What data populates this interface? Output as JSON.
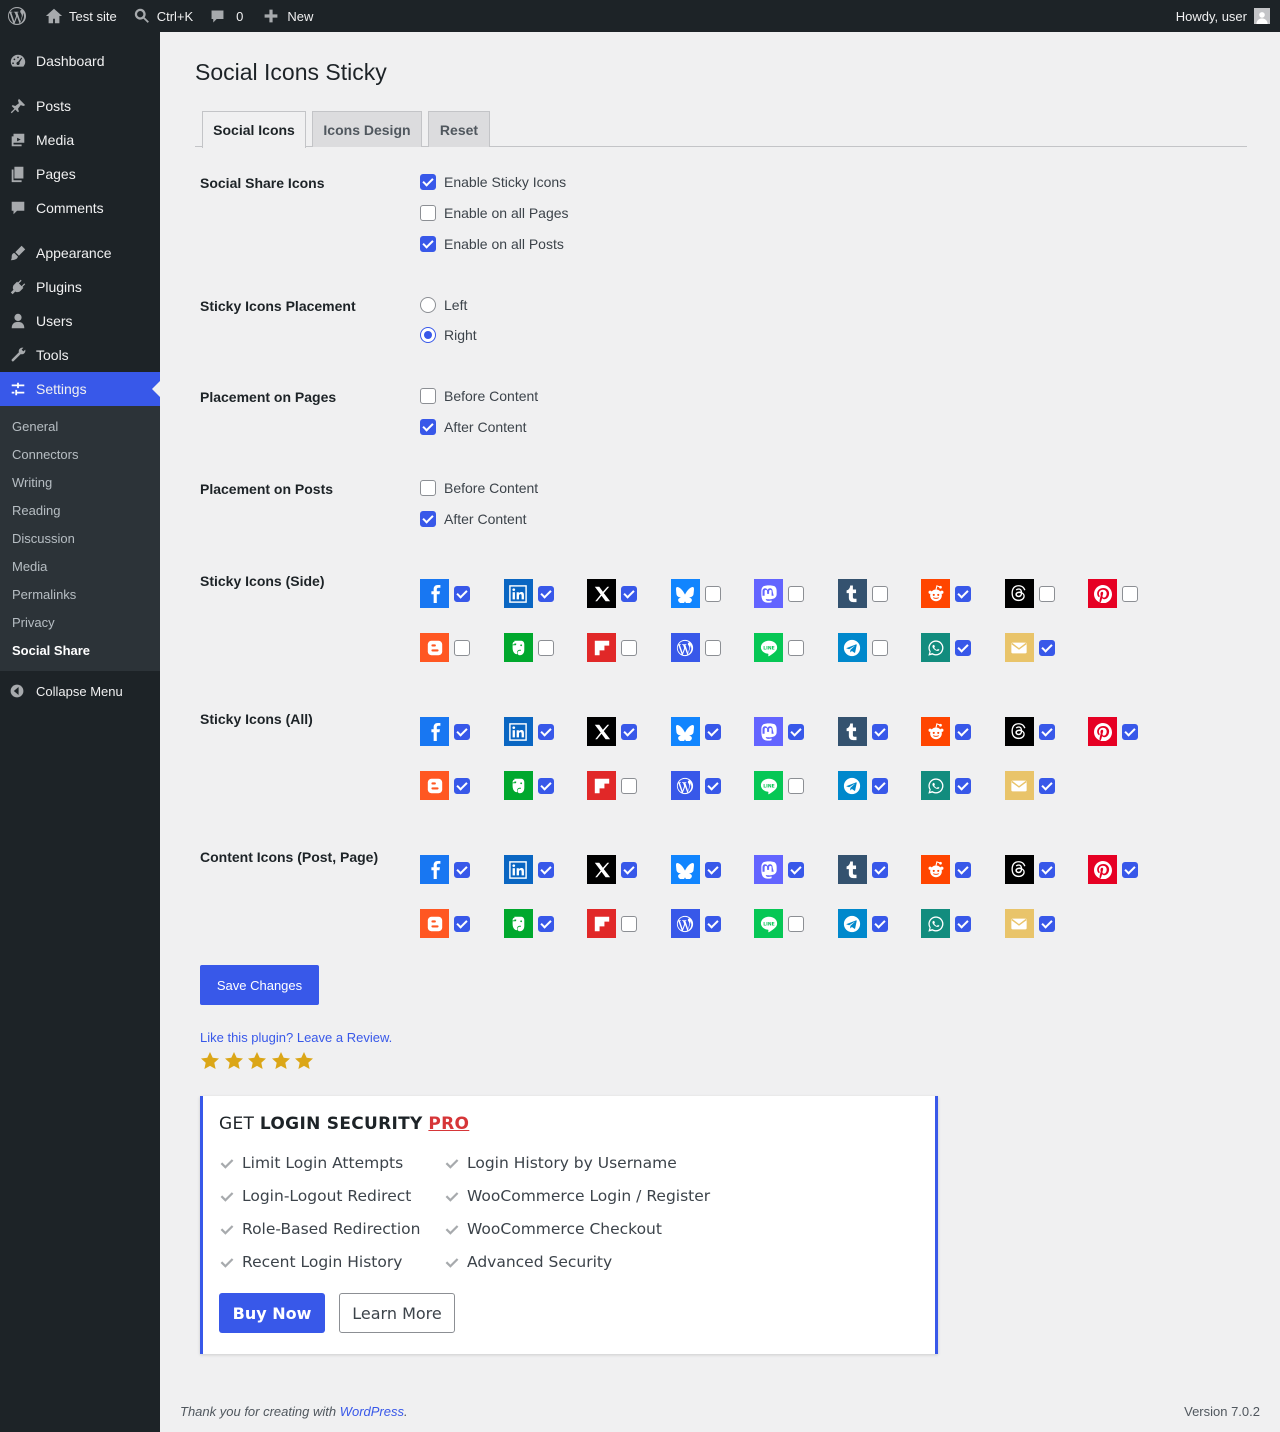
{
  "adminbar": {
    "site_name": "Test site",
    "search_shortcut": "Ctrl+K",
    "comments_count": "0",
    "new_label": "New",
    "greeting": "Howdy, user"
  },
  "sidebar": {
    "items": [
      {
        "label": "Dashboard",
        "icon": "dashboard-icon"
      },
      {
        "label": "Posts",
        "icon": "pin-icon"
      },
      {
        "label": "Media",
        "icon": "media-icon"
      },
      {
        "label": "Pages",
        "icon": "pages-icon"
      },
      {
        "label": "Comments",
        "icon": "comment-icon"
      },
      {
        "label": "Appearance",
        "icon": "brush-icon"
      },
      {
        "label": "Plugins",
        "icon": "plugin-icon"
      },
      {
        "label": "Users",
        "icon": "user-icon"
      },
      {
        "label": "Tools",
        "icon": "wrench-icon"
      },
      {
        "label": "Settings",
        "icon": "settings-icon"
      }
    ],
    "submenu": [
      "General",
      "Connectors",
      "Writing",
      "Reading",
      "Discussion",
      "Media",
      "Permalinks",
      "Privacy",
      "Social Share"
    ],
    "collapse_label": "Collapse Menu"
  },
  "page": {
    "title": "Social Icons Sticky",
    "tabs": [
      "Social Icons",
      "Icons Design",
      "Reset"
    ]
  },
  "settings": {
    "social_share": {
      "label": "Social Share Icons",
      "options": [
        {
          "label": "Enable Sticky Icons",
          "checked": true
        },
        {
          "label": "Enable on all Pages",
          "checked": false
        },
        {
          "label": "Enable on all Posts",
          "checked": true
        }
      ]
    },
    "placement": {
      "label": "Sticky Icons Placement",
      "options": [
        {
          "label": "Left",
          "checked": false
        },
        {
          "label": "Right",
          "checked": true
        }
      ]
    },
    "pages_placement": {
      "label": "Placement on Pages",
      "options": [
        {
          "label": "Before Content",
          "checked": false
        },
        {
          "label": "After Content",
          "checked": true
        }
      ]
    },
    "posts_placement": {
      "label": "Placement on Posts",
      "options": [
        {
          "label": "Before Content",
          "checked": false
        },
        {
          "label": "After Content",
          "checked": true
        }
      ]
    }
  },
  "networks": [
    {
      "name": "facebook",
      "color": "#1877f2"
    },
    {
      "name": "linkedin",
      "color": "#0a66c2"
    },
    {
      "name": "x",
      "color": "#000000"
    },
    {
      "name": "bluesky",
      "color": "#1185fe"
    },
    {
      "name": "mastodon",
      "color": "#6364ff"
    },
    {
      "name": "tumblr",
      "color": "#34526f"
    },
    {
      "name": "reddit",
      "color": "#ff4500"
    },
    {
      "name": "threads",
      "color": "#000000"
    },
    {
      "name": "pinterest",
      "color": "#e60023"
    },
    {
      "name": "blogger",
      "color": "#ff5722"
    },
    {
      "name": "evernote",
      "color": "#00a82d"
    },
    {
      "name": "flipboard",
      "color": "#e12828"
    },
    {
      "name": "wordpress",
      "color": "#3858e9"
    },
    {
      "name": "line",
      "color": "#06c755"
    },
    {
      "name": "telegram",
      "color": "#0088cc"
    },
    {
      "name": "whatsapp",
      "color": "#128c7e"
    },
    {
      "name": "email",
      "color": "#e9c46a"
    }
  ],
  "icon_groups": [
    {
      "label": "Sticky Icons (Side)",
      "checked": [
        true,
        true,
        true,
        false,
        false,
        false,
        true,
        false,
        false,
        false,
        false,
        false,
        false,
        false,
        false,
        true,
        true
      ]
    },
    {
      "label": "Sticky Icons (All)",
      "checked": [
        true,
        true,
        true,
        true,
        true,
        true,
        true,
        true,
        true,
        true,
        true,
        false,
        true,
        false,
        true,
        true,
        true
      ]
    },
    {
      "label": "Content Icons (Post, Page)",
      "checked": [
        true,
        true,
        true,
        true,
        true,
        true,
        true,
        true,
        true,
        true,
        true,
        false,
        true,
        false,
        true,
        true,
        true
      ]
    }
  ],
  "actions": {
    "save_label": "Save Changes",
    "review_text": "Like this plugin? Leave a Review.",
    "rating": 5
  },
  "promo": {
    "title_prefix": "GET ",
    "title_bold": "LOGIN SECURITY",
    "title_pro": "PRO",
    "features_left": [
      "Limit Login Attempts",
      "Login-Logout Redirect",
      "Role-Based Redirection",
      "Recent Login History"
    ],
    "features_right": [
      "Login History by Username",
      "WooCommerce Login / Register",
      "WooCommerce Checkout",
      "Advanced Security"
    ],
    "buy_label": "Buy Now",
    "learn_label": "Learn More"
  },
  "footer": {
    "thanks_prefix": "Thank you for creating with ",
    "wp_link": "WordPress",
    "thanks_suffix": ".",
    "version": "Version 7.0.2"
  }
}
